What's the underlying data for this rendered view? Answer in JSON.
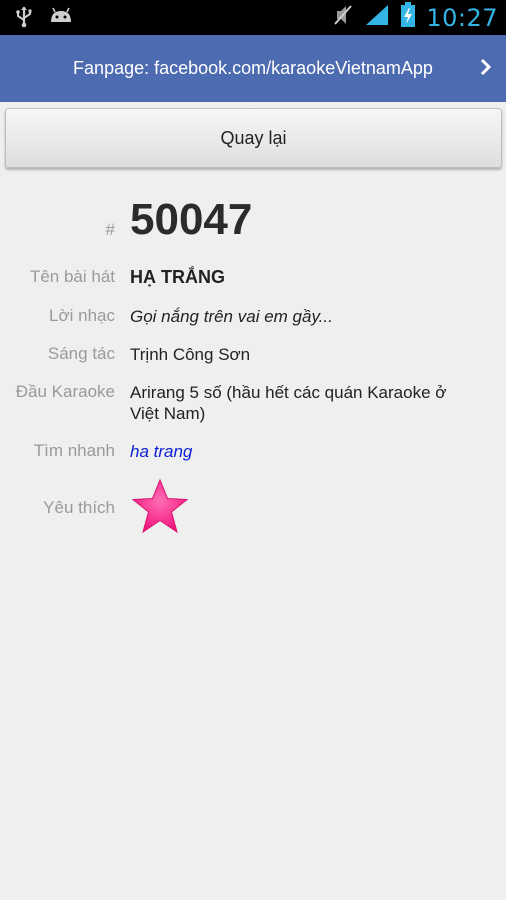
{
  "status_bar": {
    "time": "10:27",
    "icons": [
      "usb-icon",
      "android-debug-icon",
      "mute-icon",
      "signal-icon",
      "battery-charging-icon"
    ]
  },
  "banner": {
    "text": "Fanpage: facebook.com/karaokeVietnamApp",
    "chevron": "chevron-right-icon",
    "color": "#4d6bb0"
  },
  "back_button": {
    "label": "Quay lại"
  },
  "song": {
    "number_label": "#",
    "number": "50047",
    "title_label": "Tên bài hát",
    "title": "HẠ TRẮNG",
    "lyrics_label": "Lời nhạc",
    "lyrics": "Gọi nắng trên vai em gầy...",
    "composer_label": "Sáng tác",
    "composer": "Trịnh Công Sơn",
    "karaoke_label": "Đầu Karaoke",
    "karaoke": "Arirang 5 số (hầu hết các quán Karaoke ở Việt Nam)",
    "quick_search_label": "Tìm nhanh",
    "quick_search": "ha trang",
    "favorite_label": "Yêu thích",
    "favorite_icon": "star-icon",
    "favorite_color": "#ff2d8f"
  }
}
